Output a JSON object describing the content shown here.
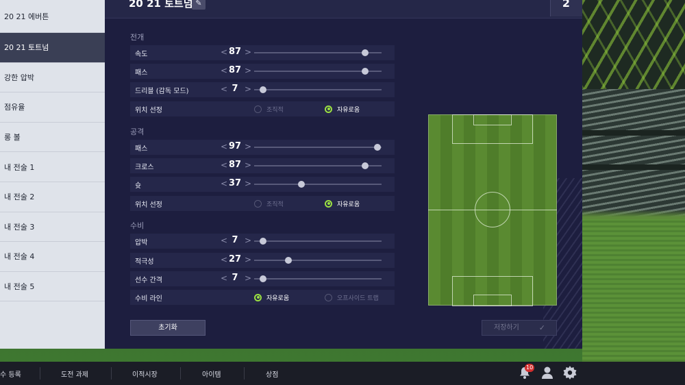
{
  "sidebar": {
    "items": [
      {
        "label": "20 21 에버튼"
      },
      {
        "label": "20 21 토트넘"
      },
      {
        "label": "강한 압박"
      },
      {
        "label": "점유율"
      },
      {
        "label": "롱 볼"
      },
      {
        "label": "내 전술 1"
      },
      {
        "label": "내 전술 2"
      },
      {
        "label": "내 전술 3"
      },
      {
        "label": "내 전술 4"
      },
      {
        "label": "내 전술 5"
      }
    ],
    "active_index": 1
  },
  "panel": {
    "title": "20 21 토트넘",
    "edit_icon": "edit-icon",
    "slot_number": "2"
  },
  "sections": {
    "buildup": {
      "label": "전개",
      "speed": {
        "label": "속도",
        "value": "87",
        "fraction": 0.87
      },
      "passing": {
        "label": "패스",
        "value": "87",
        "fraction": 0.87
      },
      "dribbling": {
        "label": "드리블 (감독 모드)",
        "value": "7",
        "fraction": 0.07
      },
      "positioning": {
        "label": "위치 선정",
        "option_a": "조직적",
        "option_b": "자유로움",
        "selected": "option_b"
      }
    },
    "attack": {
      "label": "공격",
      "passing": {
        "label": "패스",
        "value": "97",
        "fraction": 0.97
      },
      "crossing": {
        "label": "크로스",
        "value": "87",
        "fraction": 0.87
      },
      "shooting": {
        "label": "슛",
        "value": "37",
        "fraction": 0.37
      },
      "positioning": {
        "label": "위치 선정",
        "option_a": "조직적",
        "option_b": "자유로움",
        "selected": "option_b"
      }
    },
    "defence": {
      "label": "수비",
      "pressure": {
        "label": "압박",
        "value": "7",
        "fraction": 0.07
      },
      "aggression": {
        "label": "적극성",
        "value": "27",
        "fraction": 0.27
      },
      "width": {
        "label": "선수 간격",
        "value": "7",
        "fraction": 0.07
      },
      "line": {
        "label": "수비 라인",
        "option_a": "자유로움",
        "option_b": "오프사이드 트랩",
        "selected": "option_a"
      }
    }
  },
  "buttons": {
    "reset": "초기화",
    "save": "저장하기"
  },
  "bottom_nav": {
    "items": [
      "수 등록",
      "도전 과제",
      "이적시장",
      "아이템",
      "상점"
    ],
    "notification_count": "10",
    "icons": [
      "bell-icon",
      "profile-icon",
      "settings-icon"
    ]
  },
  "colors": {
    "accent": "#9be042",
    "panel_bg": "#1d1e3f",
    "active_item_bg": "#3a3f55",
    "badge": "#d32f2f"
  }
}
